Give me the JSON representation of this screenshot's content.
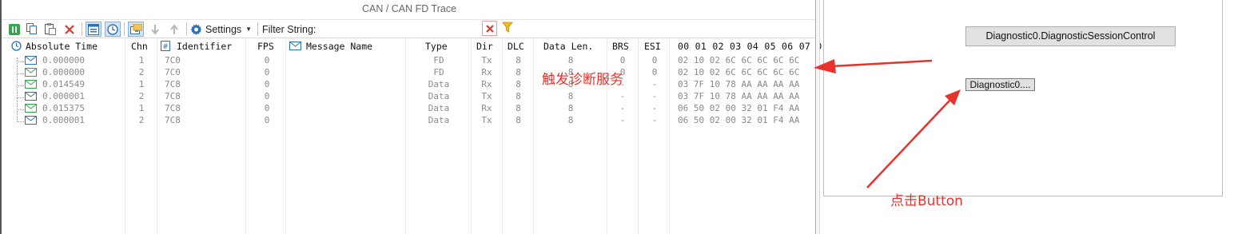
{
  "window": {
    "title": "CAN / CAN FD Trace"
  },
  "toolbar": {
    "buttons": [
      {
        "icon": "pause-icon"
      },
      {
        "icon": "copy-icon"
      },
      {
        "icon": "paste-icon"
      },
      {
        "icon": "delete-icon"
      },
      {
        "icon": "fixed-position-icon"
      },
      {
        "icon": "clock-icon"
      },
      {
        "icon": "import-icon"
      },
      {
        "icon": "arrow-down-icon"
      },
      {
        "icon": "arrow-up-icon"
      }
    ],
    "settings_label": "Settings",
    "filter_label": "Filter String:",
    "filter_value": "",
    "filter_clear_icon": "red-x-icon",
    "filter_icon": "funnel-icon"
  },
  "columns": {
    "absolute_time": "Absolute Time",
    "chn": "Chn",
    "identifier": "Identifier",
    "fps": "FPS",
    "message_name": "Message Name",
    "type": "Type",
    "dir": "Dir",
    "dlc": "DLC",
    "data_len": "Data Len.",
    "brs": "BRS",
    "esi": "ESI",
    "data": "00 01 02 03 04 05 06 07 0"
  },
  "rows": [
    {
      "time": "0.000000",
      "chn": "1",
      "id": "7C0",
      "fps": "0",
      "name": "",
      "type": "FD",
      "dir": "Tx",
      "dlc": "8",
      "len": "8",
      "brs": "0",
      "esi": "0",
      "data": "02 10 02 6C 6C 6C 6C 6C"
    },
    {
      "time": "0.000000",
      "chn": "2",
      "id": "7C0",
      "fps": "0",
      "name": "",
      "type": "FD",
      "dir": "Rx",
      "dlc": "8",
      "len": "8",
      "brs": "0",
      "esi": "0",
      "data": "02 10 02 6C 6C 6C 6C 6C"
    },
    {
      "time": "0.014549",
      "chn": "1",
      "id": "7C8",
      "fps": "0",
      "name": "",
      "type": "Data",
      "dir": "Rx",
      "dlc": "8",
      "len": "8",
      "brs": "-",
      "esi": "-",
      "data": "03 7F 10 78 AA AA AA AA"
    },
    {
      "time": "0.000001",
      "chn": "2",
      "id": "7C8",
      "fps": "0",
      "name": "",
      "type": "Data",
      "dir": "Tx",
      "dlc": "8",
      "len": "8",
      "brs": "-",
      "esi": "-",
      "data": "03 7F 10 78 AA AA AA AA"
    },
    {
      "time": "0.015375",
      "chn": "1",
      "id": "7C8",
      "fps": "0",
      "name": "",
      "type": "Data",
      "dir": "Rx",
      "dlc": "8",
      "len": "8",
      "brs": "-",
      "esi": "-",
      "data": "06 50 02 00 32 01 F4 AA"
    },
    {
      "time": "0.000001",
      "chn": "2",
      "id": "7C8",
      "fps": "0",
      "name": "",
      "type": "Data",
      "dir": "Tx",
      "dlc": "8",
      "len": "8",
      "brs": "-",
      "esi": "-",
      "data": "06 50 02 00 32 01 F4 AA"
    }
  ],
  "panel": {
    "button_full": "Diagnostic0.DiagnosticSessionControl",
    "button_small": "Diagnostic0...."
  },
  "annotations": {
    "trigger_label": "触发诊断服务",
    "click_label": "点击Button",
    "color": "#e8322c"
  },
  "colors": {
    "icon_green": "#2ea84a",
    "icon_blue": "#2f6fb3",
    "selected_bg": "#cfe4f8"
  }
}
